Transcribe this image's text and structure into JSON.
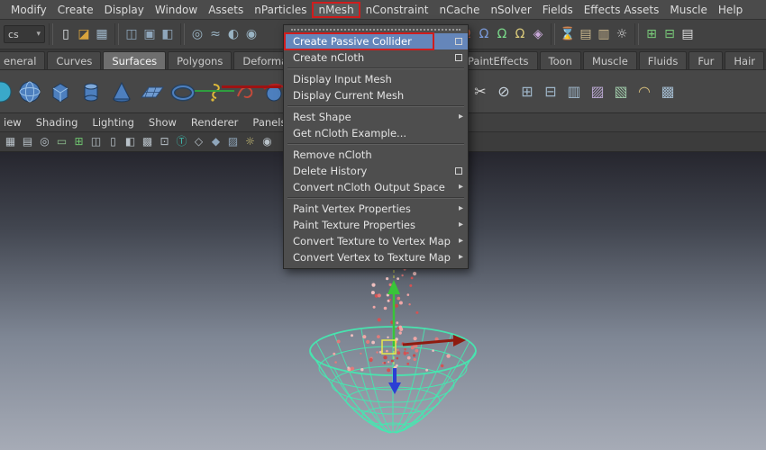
{
  "colors": {
    "menu_highlight": "#6586ba",
    "annotation_red": "#cf1d1d",
    "wireframe_green": "#46e8b0",
    "particle_red": "#d45353",
    "viewport_top": "#26262e",
    "viewport_bottom": "#a6abb6"
  },
  "menubar": {
    "items": [
      "Modify",
      "Create",
      "Display",
      "Window",
      "Assets",
      "nParticles",
      "nMesh",
      "nConstraint",
      "nCache",
      "nSolver",
      "Fields",
      "Effects Assets",
      "Muscle",
      "Help"
    ],
    "open_menu": "nMesh"
  },
  "statusline": {
    "scene_selector": "cs",
    "caret_glyph": "▾",
    "icons": [
      {
        "name": "new-scene-icon",
        "glyph": "▯"
      },
      {
        "name": "open-scene-icon",
        "glyph": "◪"
      },
      {
        "name": "save-scene-icon",
        "glyph": "▦"
      },
      {
        "name": "select-hierarchy-icon",
        "glyph": "◫"
      },
      {
        "name": "select-object-icon",
        "glyph": "▣"
      },
      {
        "name": "select-component-icon",
        "glyph": "◧"
      },
      {
        "name": "select-mask-points-icon",
        "glyph": "◎"
      },
      {
        "name": "select-mask-curves-icon",
        "glyph": "≈"
      },
      {
        "name": "select-mask-surfaces-icon",
        "glyph": "◐"
      },
      {
        "name": "select-mask-dynamics-icon",
        "glyph": "◉"
      },
      {
        "name": "snap-to-grid-icon",
        "glyph": "Ω"
      },
      {
        "name": "snap-to-curve-icon",
        "glyph": "Ω"
      },
      {
        "name": "snap-to-point-icon",
        "glyph": "Ω"
      },
      {
        "name": "snap-to-plane-icon",
        "glyph": "Ω"
      },
      {
        "name": "make-live-icon",
        "glyph": "◈"
      },
      {
        "name": "construction-history-icon",
        "glyph": "⌛"
      },
      {
        "name": "render-icon",
        "glyph": "▤"
      },
      {
        "name": "ipr-render-icon",
        "glyph": "▥"
      },
      {
        "name": "render-settings-icon",
        "glyph": "☼"
      },
      {
        "name": "toggle-grid-icon",
        "glyph": "⊞"
      },
      {
        "name": "toggle-panel-icon",
        "glyph": "⊟"
      },
      {
        "name": "channel-box-icon",
        "glyph": "▤"
      }
    ]
  },
  "shelf": {
    "tabs": [
      "eneral",
      "Curves",
      "Surfaces",
      "Polygons",
      "Deformation",
      "PaintEffects",
      "Toon",
      "Muscle",
      "Fluids",
      "Fur",
      "Hair"
    ],
    "active_tab": "Surfaces",
    "left_icons": [
      "nurbs-sphere-icon",
      "nurbs-cube-icon",
      "nurbs-cylinder-icon",
      "nurbs-cone-icon",
      "nurbs-plane-icon",
      "nurbs-torus-icon",
      "revolve-icon",
      "bevel-icon",
      "loft-icon"
    ],
    "right_icons": [
      {
        "name": "trim-icon",
        "glyph": "✂"
      },
      {
        "name": "untrim-icon",
        "glyph": "⊘"
      },
      {
        "name": "attach-icon",
        "glyph": "⊞"
      },
      {
        "name": "detach-icon",
        "glyph": "⊟"
      },
      {
        "name": "insert-isoparm-icon",
        "glyph": "▥"
      },
      {
        "name": "extend-surface-icon",
        "glyph": "▨"
      },
      {
        "name": "offset-surface-icon",
        "glyph": "▧"
      },
      {
        "name": "fillet-icon",
        "glyph": "◠"
      },
      {
        "name": "rebuild-icon",
        "glyph": "▩"
      }
    ]
  },
  "panel_menubar": {
    "items": [
      "iew",
      "Shading",
      "Lighting",
      "Show",
      "Renderer",
      "Panels"
    ]
  },
  "panel_toolbar": {
    "icons": [
      {
        "name": "select-camera-icon",
        "glyph": "▦"
      },
      {
        "name": "camera-settings-icon",
        "glyph": "▤"
      },
      {
        "name": "bookmark-icon",
        "glyph": "◎"
      },
      {
        "name": "image-plane-icon",
        "glyph": "▭"
      },
      {
        "name": "grid-icon",
        "glyph": "⊞"
      },
      {
        "name": "film-gate-icon",
        "glyph": "◫"
      },
      {
        "name": "resolution-gate-icon",
        "glyph": "▯"
      },
      {
        "name": "gate-mask-icon",
        "glyph": "◧"
      },
      {
        "name": "field-chart-icon",
        "glyph": "▩"
      },
      {
        "name": "safe-action-icon",
        "glyph": "⊡"
      },
      {
        "name": "safe-title-icon",
        "glyph": "Ⓣ"
      },
      {
        "name": "wireframe-icon",
        "glyph": "◇"
      },
      {
        "name": "shaded-icon",
        "glyph": "◆"
      },
      {
        "name": "textured-icon",
        "glyph": "▨"
      },
      {
        "name": "lights-icon",
        "glyph": "☼"
      },
      {
        "name": "isolate-select-icon",
        "glyph": "◉"
      }
    ]
  },
  "nmesh_menu": {
    "submenu_arrow_glyph": "▸",
    "items": [
      {
        "label": "Create Passive Collider",
        "option_box": true,
        "highlighted": true,
        "annotated": true
      },
      {
        "label": "Create nCloth",
        "option_box": true
      },
      {
        "label": "Display Input Mesh"
      },
      {
        "label": "Display Current Mesh"
      },
      {
        "label": "Rest Shape",
        "submenu": true
      },
      {
        "label": "Get nCloth Example..."
      },
      {
        "label": "Remove nCloth"
      },
      {
        "label": "Delete History",
        "option_box": true
      },
      {
        "label": "Convert nCloth Output Space",
        "submenu": true
      },
      {
        "label": "Paint Vertex Properties",
        "submenu": true
      },
      {
        "label": "Paint Texture Properties",
        "submenu": true
      },
      {
        "label": "Convert Texture to Vertex Map",
        "submenu": true
      },
      {
        "label": "Convert Vertex to Texture Map",
        "submenu": true
      }
    ]
  }
}
